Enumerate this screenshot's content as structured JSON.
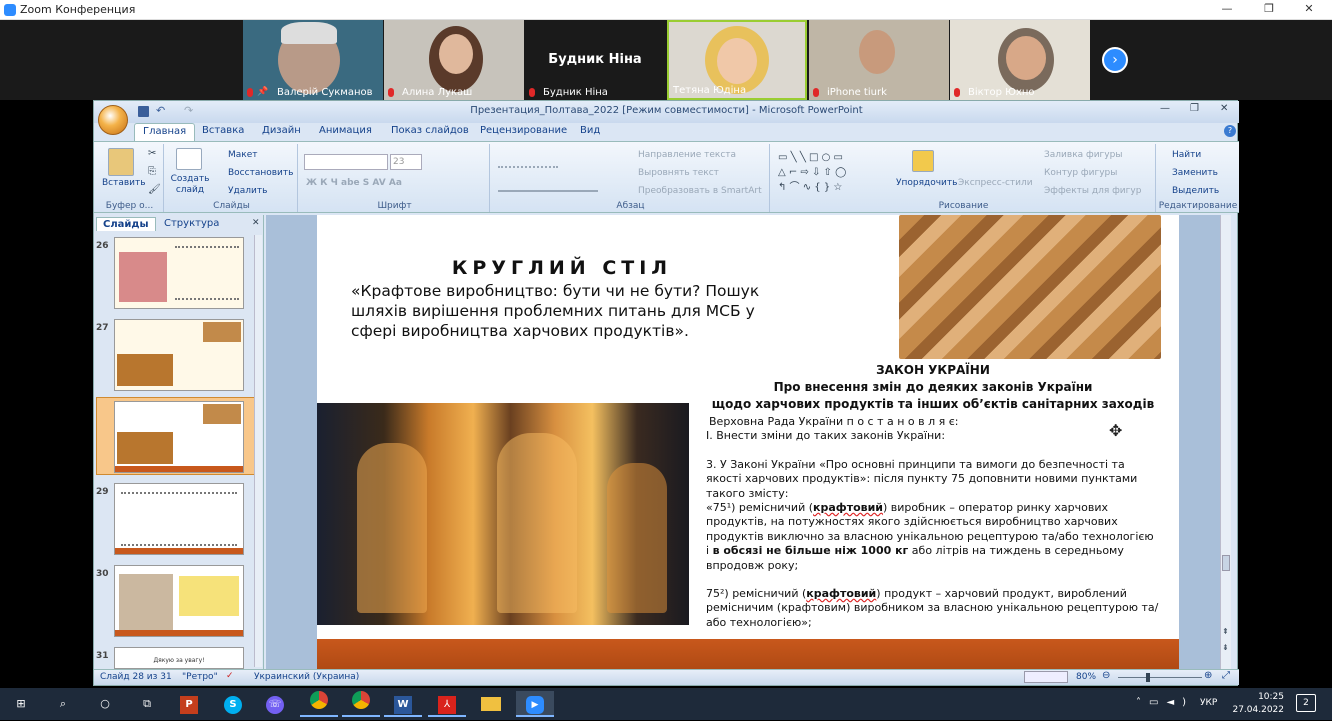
{
  "zoom": {
    "title": "Zoom Конференция",
    "participants": [
      {
        "name": "Валерій Сукманов",
        "muted": true,
        "pinned": true
      },
      {
        "name": "Алина Лукаш",
        "muted": true
      },
      {
        "name": "Будник Ніна",
        "muted": true,
        "big_name": "Будник Ніна"
      },
      {
        "name": "Тетяна Юдіна",
        "muted": false,
        "active_speaker": true
      },
      {
        "name": "iPhone tiurk",
        "muted": true
      },
      {
        "name": "Віктор Юхно",
        "muted": true
      }
    ]
  },
  "ppt": {
    "window_title": "Презентация_Полтава_2022 [Режим совместимости] - Microsoft PowerPoint",
    "tabs": [
      "Главная",
      "Вставка",
      "Дизайн",
      "Анимация",
      "Показ слайдов",
      "Рецензирование",
      "Вид"
    ],
    "active_tab": "Главная",
    "ribbon": {
      "paste": "Вставить",
      "clipboard": "Буфер о...",
      "create_slide": "Создать слайд",
      "layout": "Макет",
      "restore": "Восстановить",
      "delete": "Удалить",
      "slides_group": "Слайды",
      "font_size": "23",
      "font_group": "Шрифт",
      "text_direction": "Направление текста",
      "align_text": "Выровнять текст",
      "smartart": "Преобразовать в SmartArt",
      "paragraph_group": "Абзац",
      "arrange": "Упорядочить",
      "quick_styles": "Экспресс-стили",
      "shape_fill": "Заливка фигуры",
      "shape_outline": "Контур фигуры",
      "shape_effects": "Эффекты для фигур",
      "drawing_group": "Рисование",
      "find": "Найти",
      "replace": "Заменить",
      "select": "Выделить",
      "editing_group": "Редактирование"
    },
    "panel_tabs": [
      "Слайды",
      "Структура"
    ],
    "slide_numbers": [
      "26",
      "27",
      "28",
      "29",
      "30",
      "31"
    ],
    "selected_slide": "28",
    "thumb31_text": "Дякую за увагу!",
    "slide": {
      "heading": "КРУГЛИЙ СТІЛ",
      "subtitle": "«Крафтове виробництво: бути чи не бути? Пошук шляхів вирішення проблемних питань для МСБ у сфері виробництва харчових продуктів».",
      "law_title": "ЗАКОН УКРАЇНИ",
      "law_line1": "Про внесення змін до деяких законів України",
      "law_line2": "щодо харчових продуктів та інших об’єктів санітарних заходів",
      "p1": "Верховна Рада України п о с т а н о в л я є:",
      "p2": "I. Внести зміни до таких законів України:",
      "p3": "3. У Законі України «Про основні принципи та вимоги до безпечності та якості харчових продуктів»: після пункту 75 доповнити новими пунктами такого змісту:",
      "p4_a": "«75¹) ремісничий (",
      "p4_b": "крафтовий",
      "p4_c": ") виробник – оператор ринку харчових продуктів, на потужностях якого здійснюється виробництво харчових продуктів виключно за власною унікальною рецептурою та/або технологією і ",
      "p4_d": "в обсязі не більше ніж 1000 кг",
      "p4_e": " або літрів на тиждень в середньому впродовж року;",
      "p5_a": "75²) ремісничий (",
      "p5_b": "крафтовий",
      "p5_c": ") продукт – харчовий продукт, вироблений ремісничим (крафтовим) виробником за власною унікальною рецептурою та/або технологією»;"
    },
    "status": {
      "slide_of": "Слайд 28 из 31",
      "theme": "\"Ретро\"",
      "language": "Украинский (Украина)",
      "zoom": "80%"
    }
  },
  "taskbar": {
    "apps": [
      "windows-start",
      "search",
      "cortana",
      "task-view",
      "powerpoint",
      "skype",
      "viber",
      "chrome",
      "chrome-2",
      "word",
      "acrobat",
      "explorer",
      "zoom"
    ],
    "lang": "УКР",
    "time": "10:25",
    "date": "27.04.2022",
    "notifications": "2"
  }
}
